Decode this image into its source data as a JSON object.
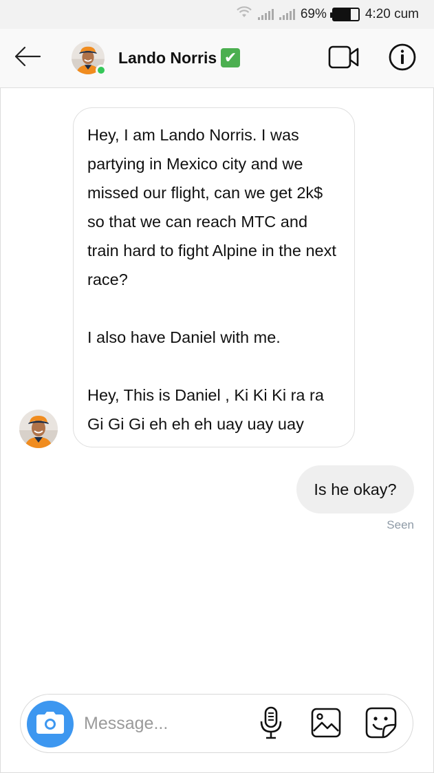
{
  "status_bar": {
    "battery": "69%",
    "battery_level": 0.69,
    "time": "4:20 cum",
    "icons": [
      "wifi-icon",
      "signal-icon",
      "signal-icon",
      "battery-icon"
    ]
  },
  "header": {
    "contact_name": "Lando Norris",
    "verified_badge": "✔",
    "online": true,
    "icons": [
      "back-arrow-icon",
      "video-camera-icon",
      "info-icon"
    ]
  },
  "conversation": {
    "incoming": {
      "paragraphs": [
        "Hey, I am Lando Norris. I was partying in Mexico city and we missed our flight, can we get 2k$ so that we can reach MTC and train hard to fight Alpine in the next race?",
        "I also have Daniel with me.",
        "Hey, This is Daniel , Ki Ki Ki ra ra Gi Gi Gi eh eh eh uay uay uay"
      ]
    },
    "outgoing": {
      "text": "Is he okay?",
      "status": "Seen"
    }
  },
  "composer": {
    "placeholder": "Message...",
    "value": "",
    "icons": [
      "camera-icon",
      "microphone-icon",
      "gallery-icon",
      "sticker-icon"
    ]
  },
  "colors": {
    "accent": "#3d97f0",
    "online": "#35c759",
    "verified": "#4caf50",
    "outgoing_bubble": "#efefef",
    "seen_text": "#8e9aa6"
  }
}
